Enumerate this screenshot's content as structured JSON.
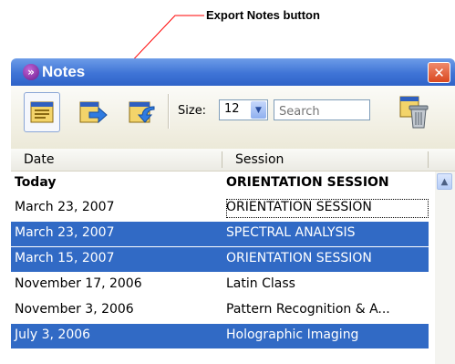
{
  "callout": {
    "label": "Export Notes button"
  },
  "background_fragments": {
    "p": "p",
    "r": "r"
  },
  "window": {
    "title": "Notes",
    "title_icon": "»",
    "close_glyph": "✕"
  },
  "toolbar": {
    "buttons": [
      {
        "name": "notes-list-button",
        "icon": "notes-window-icon",
        "active": true
      },
      {
        "name": "export-notes-button",
        "icon": "export-arrow-icon",
        "active": false
      },
      {
        "name": "import-notes-button",
        "icon": "import-arrow-icon",
        "active": false
      }
    ],
    "size_label": "Size:",
    "size_value": "12",
    "search_placeholder": "Search",
    "trash_icon": "trash-icon"
  },
  "table": {
    "columns": [
      "Date",
      "Session"
    ],
    "rows": [
      {
        "date": "Today",
        "session": "ORIENTATION SESSION",
        "style": "bold"
      },
      {
        "date": "March 23, 2007",
        "session": "ORIENTATION SESSION",
        "style": "focused"
      },
      {
        "date": "March 23, 2007",
        "session": "SPECTRAL ANALYSIS",
        "style": "selected"
      },
      {
        "date": "March 15, 2007",
        "session": "ORIENTATION SESSION",
        "style": "selected"
      },
      {
        "date": "November 17, 2006",
        "session": "Latin Class",
        "style": "normal"
      },
      {
        "date": "November 3, 2006",
        "session": "Pattern Recognition & A...",
        "style": "normal"
      },
      {
        "date": "July 3, 2006",
        "session": "Holographic Imaging",
        "style": "selected"
      }
    ]
  },
  "colors": {
    "titlebar": "#3f74d6",
    "selection": "#316ac5",
    "close": "#d9481f"
  }
}
